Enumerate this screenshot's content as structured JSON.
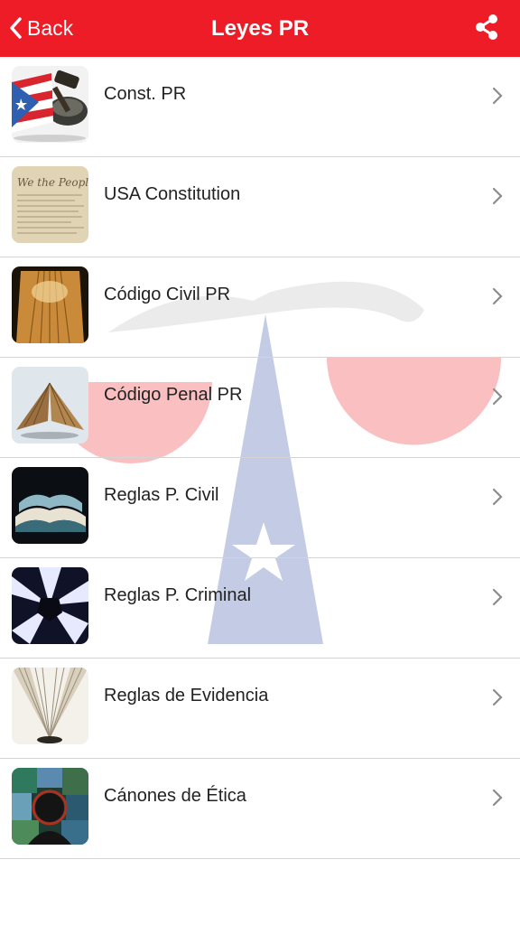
{
  "navbar": {
    "back_label": "Back",
    "title": "Leyes PR",
    "back_icon": "chevron-left-icon",
    "share_icon": "share-icon"
  },
  "colors": {
    "accent": "#ee1c26",
    "text": "#222222",
    "divider": "#d4d4d4",
    "chevron": "#8c8c8c"
  },
  "items": [
    {
      "label": "Const. PR",
      "icon": "puerto-rico-flag-gavel-thumbnail"
    },
    {
      "label": "USA Constitution",
      "icon": "parchment-document-thumbnail"
    },
    {
      "label": "Código Civil PR",
      "icon": "open-book-thumbnail"
    },
    {
      "label": "Código Penal PR",
      "icon": "standing-book-thumbnail"
    },
    {
      "label": "Reglas P. Civil",
      "icon": "open-book-blue-thumbnail"
    },
    {
      "label": "Reglas P. Criminal",
      "icon": "light-burst-thumbnail"
    },
    {
      "label": "Reglas de Evidencia",
      "icon": "book-pages-thumbnail"
    },
    {
      "label": "Cánones de Ética",
      "icon": "stained-glass-thumbnail"
    }
  ]
}
